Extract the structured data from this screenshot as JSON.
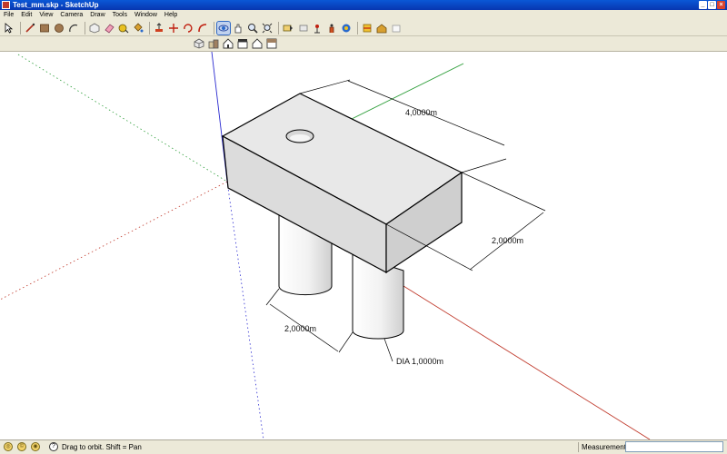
{
  "window": {
    "title": "Test_mm.skp - SketchUp",
    "min": "_",
    "max": "□",
    "close": "×"
  },
  "menu": [
    "File",
    "Edit",
    "View",
    "Camera",
    "Draw",
    "Tools",
    "Window",
    "Help"
  ],
  "toolbar": {
    "tools": [
      "select-icon",
      "line-icon",
      "rectangle-icon",
      "circle-icon",
      "arc-icon",
      "make-component-icon",
      "eraser-icon",
      "tape-measure-icon",
      "paint-bucket-icon",
      "push-pull-icon",
      "move-icon",
      "rotate-icon",
      "follow-me-icon",
      "orbit-icon",
      "pan-icon",
      "zoom-icon",
      "zoom-extents-icon",
      "previous-view-icon",
      "next-view-icon",
      "position-camera-icon",
      "walk-icon",
      "look-around-icon",
      "section-plane-icon",
      "3d-warehouse-icon",
      "components-icon",
      "share-model-icon"
    ],
    "active_tool": "orbit-icon",
    "views": [
      "iso-view-icon",
      "top-view-icon",
      "front-view-icon",
      "right-view-icon",
      "back-view-icon",
      "left-view-icon"
    ]
  },
  "model": {
    "dimensions": [
      "4,0000m",
      "2,0000m",
      "2,0000m",
      "DIA 1,0000m"
    ],
    "colors": {
      "red_axis": "#c0392b",
      "green_axis": "#2e9e3a",
      "blue_axis": "#2a2ad0",
      "face": "#e4e4e4"
    }
  },
  "status": {
    "hint": "Drag to orbit.  Shift = Pan",
    "measurements_label": "Measurements",
    "measurements_value": ""
  }
}
